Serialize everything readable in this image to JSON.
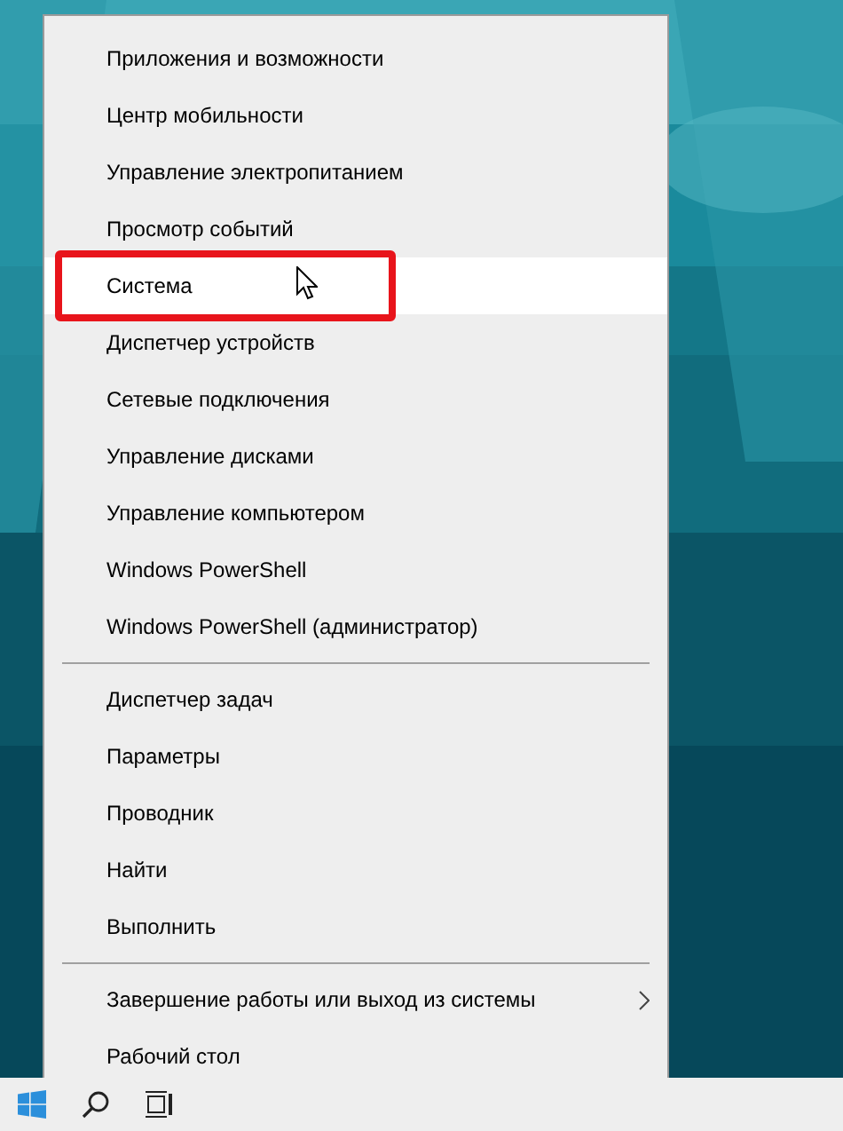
{
  "context_menu": {
    "items": [
      {
        "kind": "item",
        "label": "Приложения и возможности",
        "selected": false
      },
      {
        "kind": "item",
        "label": "Центр мобильности",
        "selected": false
      },
      {
        "kind": "item",
        "label": "Управление электропитанием",
        "selected": false
      },
      {
        "kind": "item",
        "label": "Просмотр событий",
        "selected": false
      },
      {
        "kind": "item",
        "label": "Система",
        "selected": true,
        "annotated": true
      },
      {
        "kind": "item",
        "label": "Диспетчер устройств",
        "selected": false
      },
      {
        "kind": "item",
        "label": "Сетевые подключения",
        "selected": false
      },
      {
        "kind": "item",
        "label": "Управление дисками",
        "selected": false
      },
      {
        "kind": "item",
        "label": "Управление компьютером",
        "selected": false
      },
      {
        "kind": "item",
        "label": "Windows PowerShell",
        "selected": false
      },
      {
        "kind": "item",
        "label": "Windows PowerShell (администратор)",
        "selected": false
      },
      {
        "kind": "separator"
      },
      {
        "kind": "item",
        "label": "Диспетчер задач",
        "selected": false
      },
      {
        "kind": "item",
        "label": "Параметры",
        "selected": false
      },
      {
        "kind": "item",
        "label": "Проводник",
        "selected": false
      },
      {
        "kind": "item",
        "label": "Найти",
        "selected": false
      },
      {
        "kind": "item",
        "label": "Выполнить",
        "selected": false
      },
      {
        "kind": "separator"
      },
      {
        "kind": "item",
        "label": "Завершение работы или выход из системы",
        "selected": false,
        "submenu": true
      },
      {
        "kind": "item",
        "label": "Рабочий стол",
        "selected": false
      }
    ]
  }
}
